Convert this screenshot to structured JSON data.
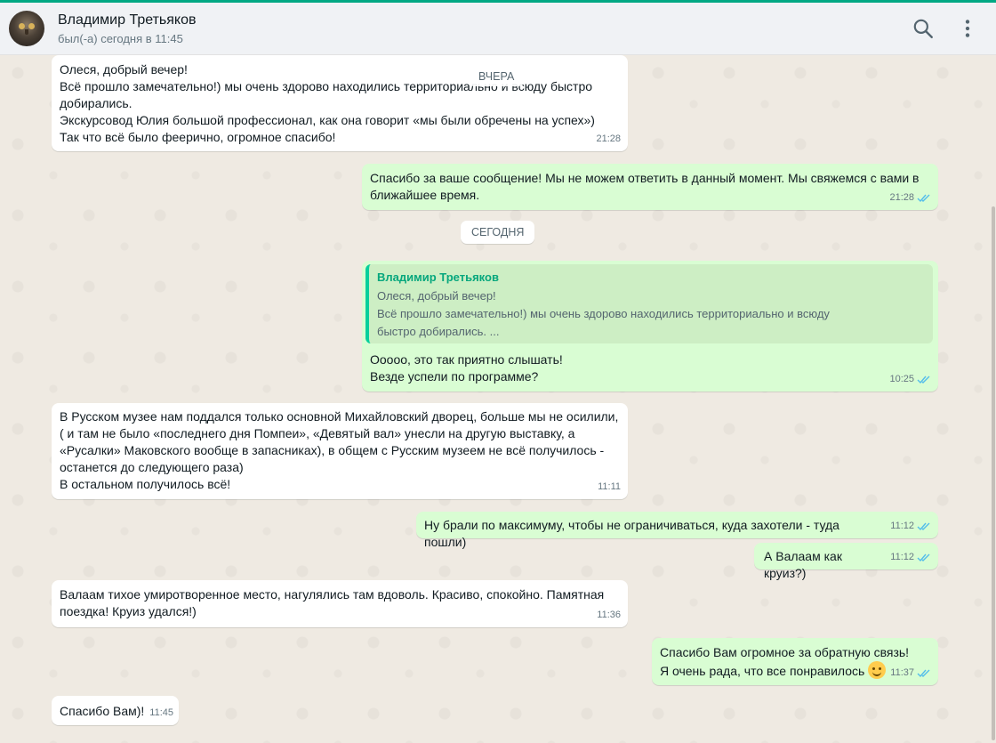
{
  "header": {
    "name": "Владимир Третьяков",
    "status": "был(-а) сегодня в 11:45",
    "search_icon": "search-icon",
    "menu_icon": "kebab-menu-icon"
  },
  "colors": {
    "accent": "#00a884",
    "incoming_bubble": "#ffffff",
    "outgoing_bubble": "#d9fdd3",
    "read_ticks": "#53bdeb"
  },
  "day_labels": {
    "yesterday": "ВЧЕРА",
    "today": "СЕГОДНЯ"
  },
  "messages": [
    {
      "direction": "in",
      "text": "Олеся, добрый вечер!\nВсё прошло замечательно!) мы очень здорово находились территориально и всюду быстро добирались.\nЭкскурсовод Юлия большой профессионал, как она говорит «мы были обречены на успех»)\nТак что всё было феерично, огромное спасибо!",
      "time": "21:28"
    },
    {
      "direction": "out",
      "text": "Спасибо за ваше сообщение! Мы не можем ответить в данный момент. Мы свяжемся с вами в ближайшее время.",
      "time": "21:28",
      "status": "read"
    },
    {
      "direction": "out",
      "quote": {
        "author": "Владимир Третьяков",
        "text": "Олеся, добрый вечер!\nВсё прошло замечательно!) мы очень здорово находились территориально и всюду\nбыстро добирались. ..."
      },
      "text": "Ооооо, это так приятно слышать!\nВезде успели по программе?",
      "time": "10:25",
      "status": "read"
    },
    {
      "direction": "in",
      "text": "В Русском музее нам поддался только основной Михайловский дворец, больше мы не осилили,\n( и там не было «последнего дня Помпеи»,  «Девятый вал» унесли на другую выставку, а\n«Русалки» Маковского вообще в запасниках), в общем с Русским музеем не всё получилось -\nостанется до следующего раза)\nВ остальном получилось всё!",
      "time": "11:11"
    },
    {
      "direction": "out",
      "text": "Ну брали по максимуму, чтобы не ограничиваться, куда захотели - туда пошли)",
      "time": "11:12",
      "status": "read"
    },
    {
      "direction": "out",
      "text": "А Валаам как круиз?)",
      "time": "11:12",
      "status": "read"
    },
    {
      "direction": "in",
      "text": "Валаам тихое умиротворенное место, нагулялись там вдоволь. Красиво, спокойно. Памятная\nпоездка! Круиз удался!)",
      "time": "11:36"
    },
    {
      "direction": "out",
      "text": "Спасибо Вам огромное за обратную связь!\nЯ очень рада, что все понравилось",
      "emoji": "smiling-face-icon",
      "time": "11:37",
      "status": "read"
    },
    {
      "direction": "in",
      "text": "Спасибо Вам)!",
      "time": "11:45"
    }
  ]
}
